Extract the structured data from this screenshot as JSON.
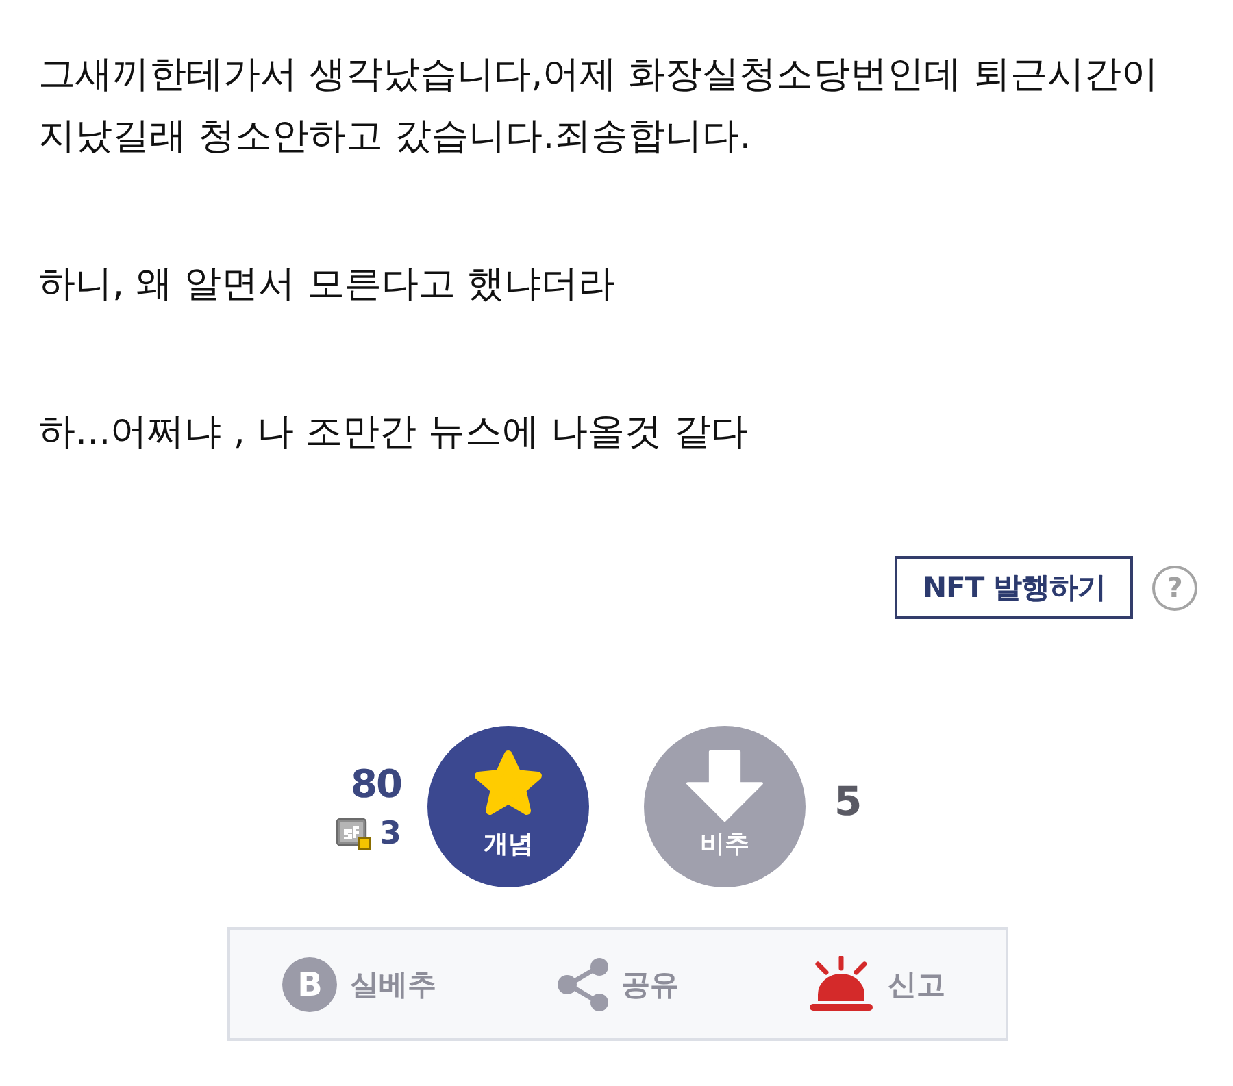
{
  "post": {
    "paragraphs": [
      "그새끼한테가서 생각났습니다,어제 화장실청소당번인데 퇴근시간이 지났길래 청소안하고 갔습니다.죄송합니다.",
      "하니, 왜 알면서 모른다고 했냐더라",
      "하...어쩌냐 , 나 조만간 뉴스에 나올것 같다"
    ]
  },
  "nft": {
    "label": "NFT 발행하기",
    "help": "?"
  },
  "votes": {
    "up": {
      "count": "80",
      "sub_count": "3",
      "label": "개념"
    },
    "down": {
      "label": "비추",
      "count": "5"
    }
  },
  "actions": [
    {
      "kind": "best",
      "icon_letter": "B",
      "label": "실베추"
    },
    {
      "kind": "share",
      "label": "공유"
    },
    {
      "kind": "report",
      "label": "신고"
    }
  ]
}
